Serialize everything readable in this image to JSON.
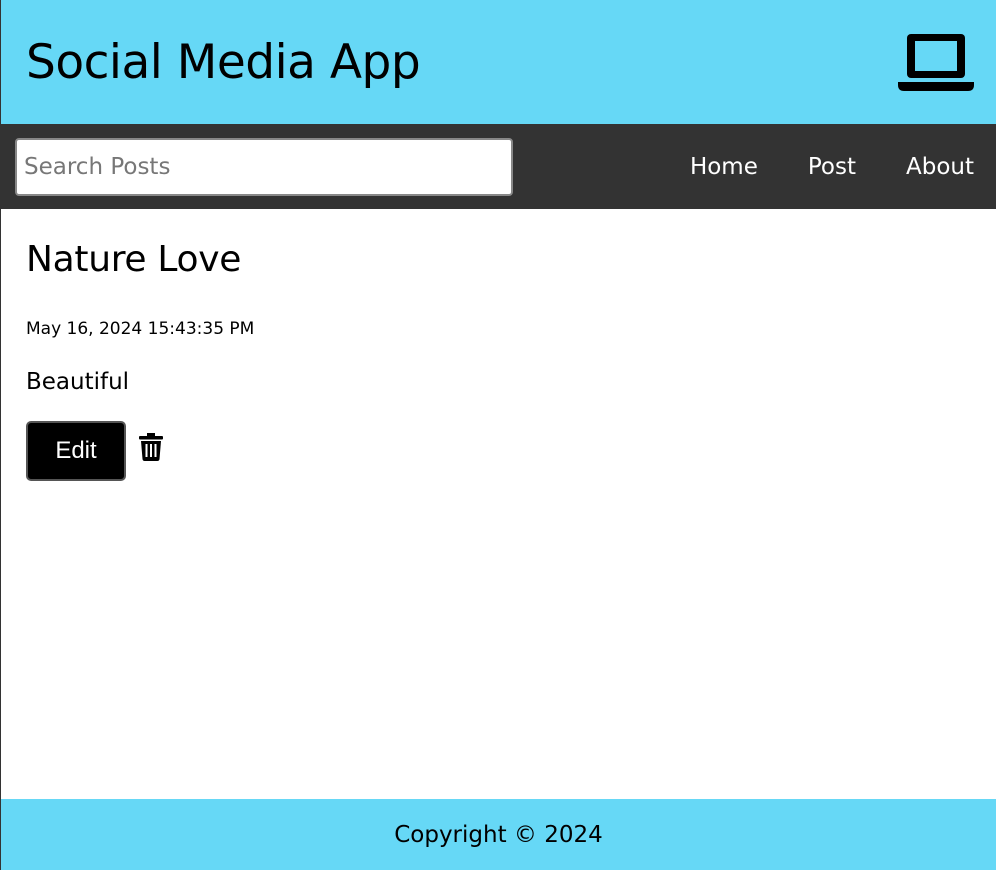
{
  "header": {
    "title": "Social Media App",
    "icon": "laptop-icon"
  },
  "nav": {
    "search": {
      "placeholder": "Search Posts",
      "value": ""
    },
    "links": [
      {
        "label": "Home"
      },
      {
        "label": "Post"
      },
      {
        "label": "About"
      }
    ]
  },
  "post": {
    "title": "Nature Love",
    "datetime": "May 16, 2024 15:43:35 PM",
    "body": "Beautiful",
    "edit_label": "Edit",
    "delete_icon": "trash-icon"
  },
  "footer": {
    "copyright": "Copyright © 2024"
  },
  "colors": {
    "header_bg": "#66d8f6",
    "nav_bg": "#333333",
    "footer_bg": "#66d8f6",
    "edit_bg": "#000000"
  }
}
